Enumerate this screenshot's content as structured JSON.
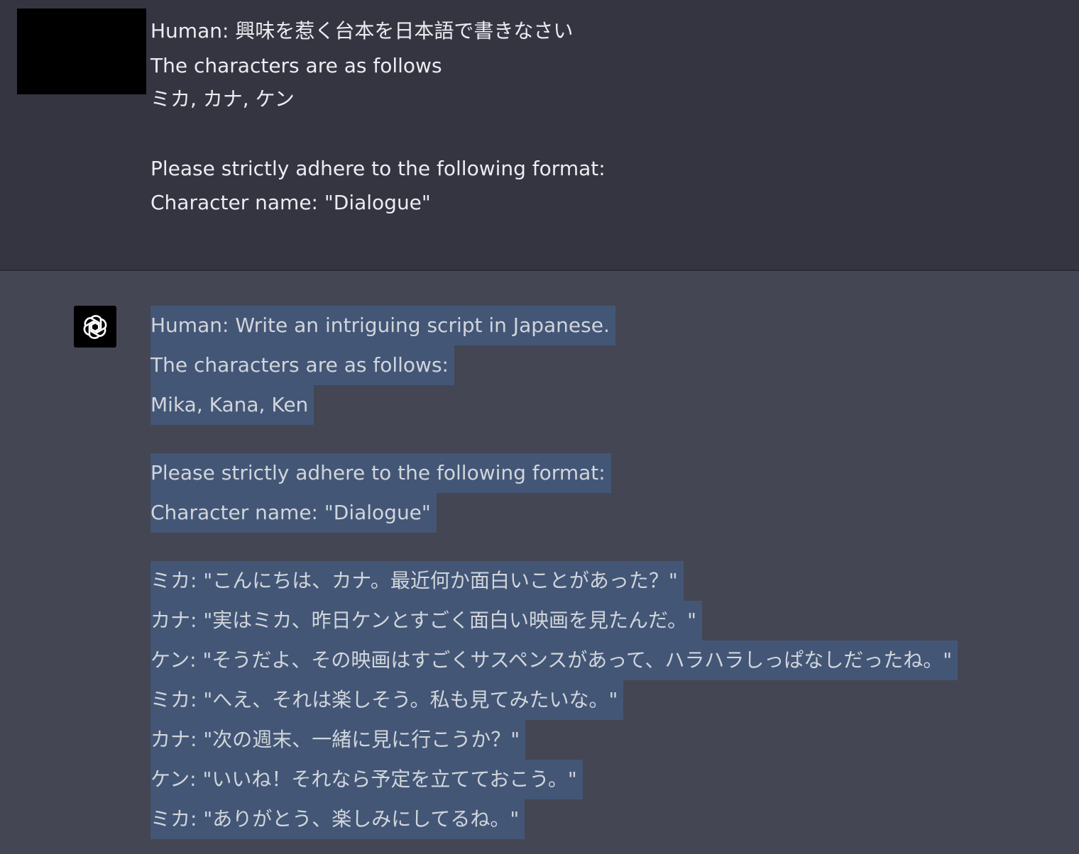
{
  "user_message": {
    "lines": [
      "Human: 興味を惹く台本を日本語で書きなさい",
      "The characters are as follows",
      "ミカ, カナ, ケン",
      "",
      "Please strictly adhere to the following format:",
      "Character name: \"Dialogue\""
    ]
  },
  "assistant_message": {
    "lines": [
      "Human: Write an intriguing script in Japanese.",
      "The characters are as follows:",
      "Mika, Kana, Ken",
      "Please strictly adhere to the following format:",
      "Character name: \"Dialogue\"",
      "ミカ: \"こんにちは、カナ。最近何か面白いことがあった？\"",
      "カナ: \"実はミカ、昨日ケンとすごく面白い映画を見たんだ。\"",
      "ケン: \"そうだよ、その映画はすごくサスペンスがあって、ハラハラしっぱなしだったね。\"",
      "ミカ: \"へえ、それは楽しそう。私も見てみたいな。\"",
      "カナ: \"次の週末、一緒に見に行こうか？\"",
      "ケン: \"いいね！それなら予定を立てておこう。\"",
      "ミカ: \"ありがとう、楽しみにしてるね。\""
    ]
  },
  "colors": {
    "user_bg": "#343541",
    "assistant_bg": "#444654",
    "selection_highlight": "#435676",
    "text": "#ececf1"
  },
  "icons": {
    "assistant_avatar": "openai-logo-icon",
    "user_avatar": "redacted-avatar"
  }
}
